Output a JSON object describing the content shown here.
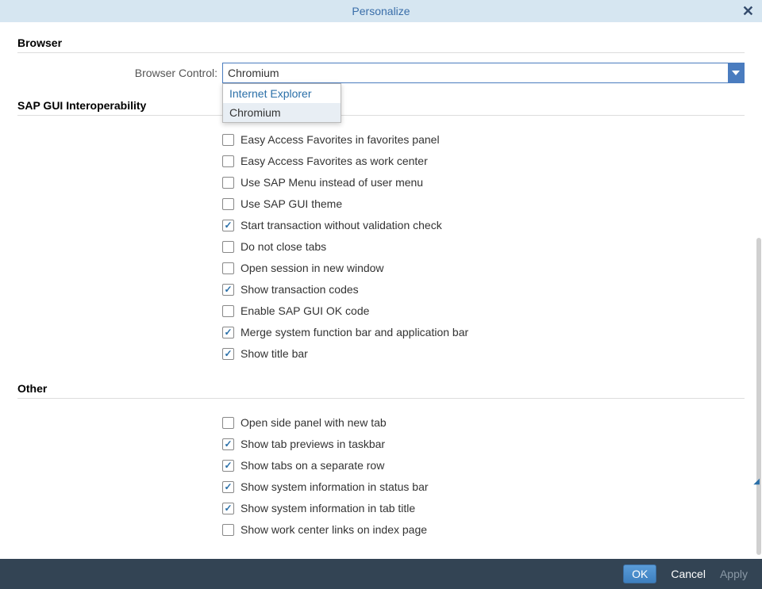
{
  "title": "Personalize",
  "sections": {
    "browser": {
      "header": "Browser",
      "field_label": "Browser Control:",
      "selected": "Chromium",
      "options": [
        "Internet Explorer",
        "Chromium"
      ]
    },
    "sapgui": {
      "header": "SAP GUI Interoperability",
      "items": [
        {
          "label": "Easy Access Favorites in favorites panel",
          "checked": false
        },
        {
          "label": "Easy Access Favorites as work center",
          "checked": false
        },
        {
          "label": "Use SAP Menu instead of user menu",
          "checked": false
        },
        {
          "label": "Use SAP GUI theme",
          "checked": false
        },
        {
          "label": "Start transaction without validation check",
          "checked": true
        },
        {
          "label": "Do not close tabs",
          "checked": false
        },
        {
          "label": "Open session in new window",
          "checked": false
        },
        {
          "label": "Show transaction codes",
          "checked": true
        },
        {
          "label": "Enable SAP GUI OK code",
          "checked": false
        },
        {
          "label": "Merge system function bar and application bar",
          "checked": true
        },
        {
          "label": "Show title bar",
          "checked": true
        }
      ]
    },
    "other": {
      "header": "Other",
      "items": [
        {
          "label": "Open side panel with new tab",
          "checked": false
        },
        {
          "label": "Show tab previews in taskbar",
          "checked": true
        },
        {
          "label": "Show tabs on a separate row",
          "checked": true
        },
        {
          "label": "Show system information in status bar",
          "checked": true
        },
        {
          "label": "Show system information in tab title",
          "checked": true
        },
        {
          "label": "Show work center links on index page",
          "checked": false
        }
      ]
    }
  },
  "footer": {
    "ok": "OK",
    "cancel": "Cancel",
    "apply": "Apply"
  }
}
